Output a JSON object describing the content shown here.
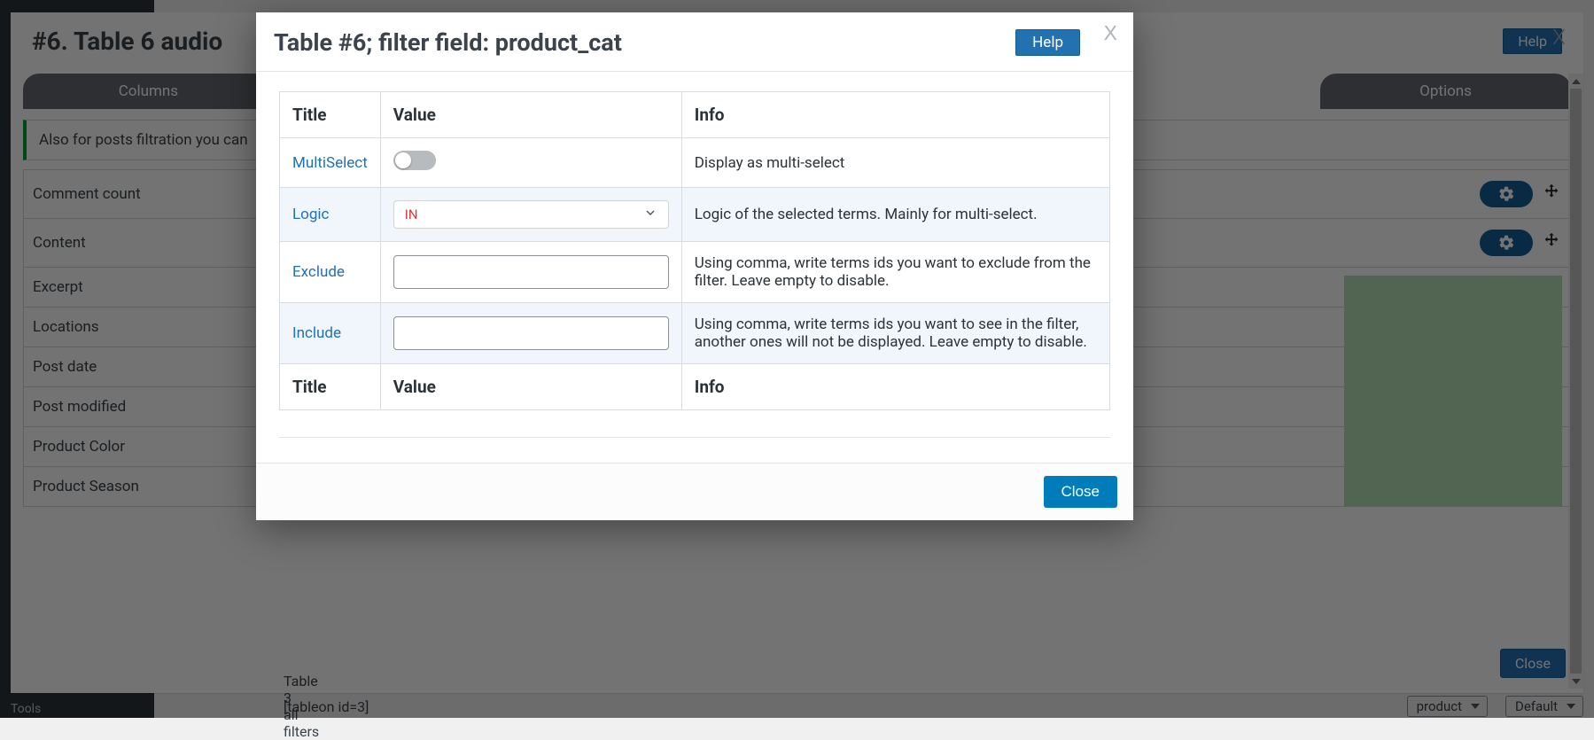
{
  "bg": {
    "admin_menu_tools": "Tools",
    "panel_title": "#6. Table 6 audio",
    "help_label": "Help",
    "close_x": "X",
    "tabs": {
      "columns": "Columns",
      "options": "Options"
    },
    "filter_notice_prefix": "Also for posts filtration you can",
    "list_items": [
      "Comment count",
      "Content",
      "Excerpt",
      "Locations",
      "Post date",
      "Post modified",
      "Product Color",
      "Product Season"
    ],
    "footer_close": "Close",
    "bottom_row": {
      "name": "Table 3 all filters",
      "shortcode": "[tableon id=3]",
      "sel1": "product",
      "sel2": "Default"
    }
  },
  "modal": {
    "title": "Table #6; filter field: product_cat",
    "help_label": "Help",
    "close_x": "X",
    "columns": {
      "title": "Title",
      "value": "Value",
      "info": "Info"
    },
    "rows": {
      "multiselect": {
        "title": "MultiSelect",
        "info": "Display as multi-select",
        "value": false
      },
      "logic": {
        "title": "Logic",
        "value": "IN",
        "info": "Logic of the selected terms. Mainly for multi-select."
      },
      "exclude": {
        "title": "Exclude",
        "value": "",
        "info": "Using comma, write terms ids you want to exclude from the filter. Leave empty to disable."
      },
      "include": {
        "title": "Include",
        "value": "",
        "info": "Using comma, write terms ids you want to see in the filter, another ones will not be displayed. Leave empty to disable."
      }
    },
    "close_label": "Close"
  }
}
